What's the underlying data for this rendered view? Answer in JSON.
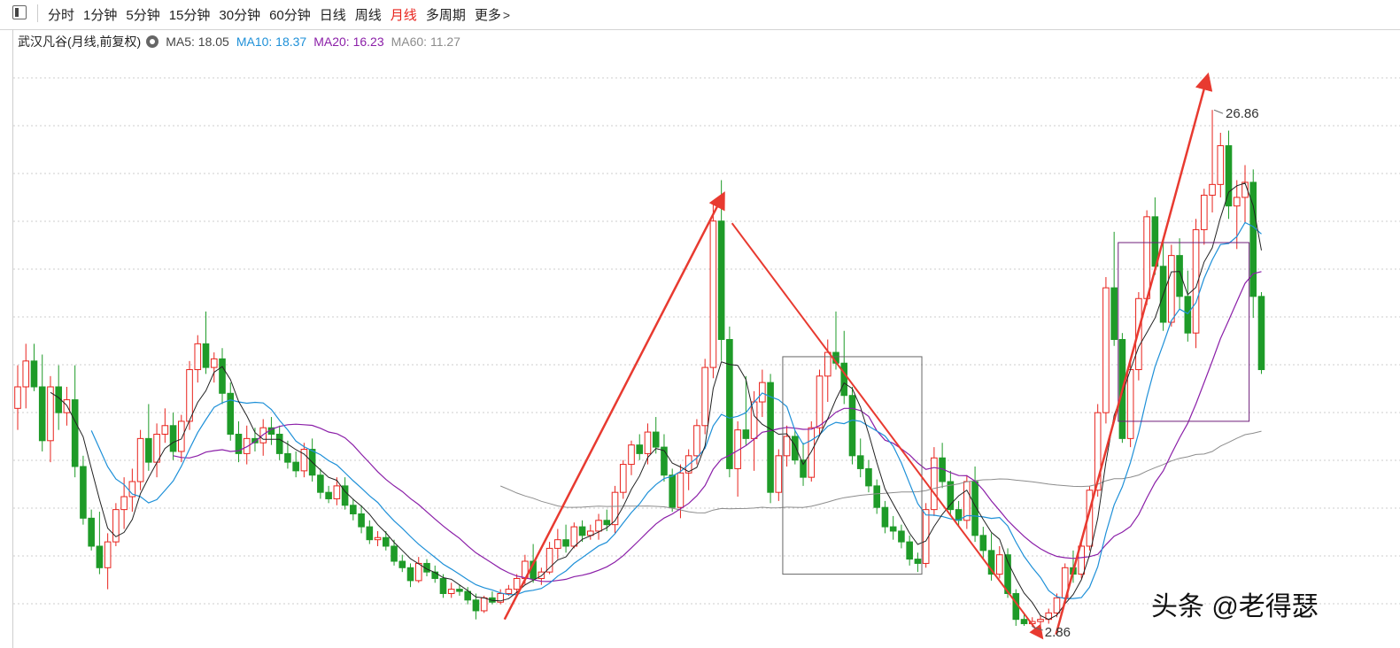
{
  "toolbar": {
    "tabs": [
      {
        "label": "分时"
      },
      {
        "label": "1分钟"
      },
      {
        "label": "5分钟"
      },
      {
        "label": "15分钟"
      },
      {
        "label": "30分钟"
      },
      {
        "label": "60分钟"
      },
      {
        "label": "日线"
      },
      {
        "label": "周线"
      },
      {
        "label": "月线",
        "active": true
      },
      {
        "label": "多周期"
      },
      {
        "label": "更多"
      }
    ]
  },
  "legend": {
    "stock_title": "武汉凡谷(月线,前复权)",
    "ma5": "MA5: 18.05",
    "ma10": "MA10: 18.37",
    "ma20": "MA20: 16.23",
    "ma60": "MA60: 11.27"
  },
  "annotations": {
    "high_label": "26.86",
    "low_label": "2.86"
  },
  "watermark": "头条 @老得瑟",
  "colors": {
    "up": "#e8231d",
    "down": "#1e9b28",
    "ma5": "#222222",
    "ma10": "#1e90d8",
    "ma20": "#8b1fa8",
    "ma60": "#8c8c8c",
    "arrow": "#e83a30",
    "grid": "#cccccc"
  },
  "chart_data": {
    "type": "candlestick",
    "period": "monthly",
    "ohlc": [
      [
        13,
        15,
        12,
        14
      ],
      [
        14,
        16,
        13,
        15.2
      ],
      [
        15.2,
        16,
        13.8,
        14
      ],
      [
        14,
        15.5,
        11,
        11.5
      ],
      [
        11.5,
        14.5,
        10.5,
        14
      ],
      [
        14,
        15,
        12,
        12.8
      ],
      [
        12.8,
        14,
        12.2,
        13.4
      ],
      [
        13.4,
        15,
        9.8,
        10.3
      ],
      [
        10.3,
        10.8,
        7.6,
        7.9
      ],
      [
        7.9,
        8.3,
        6.4,
        6.6
      ],
      [
        6.6,
        8.2,
        5.3,
        5.6
      ],
      [
        5.6,
        7.2,
        4.6,
        6.8
      ],
      [
        6.8,
        8.6,
        6.6,
        8.3
      ],
      [
        8.3,
        9.8,
        7.4,
        8.9
      ],
      [
        8.9,
        10.2,
        8.2,
        9.6
      ],
      [
        9.6,
        12,
        9.2,
        11.6
      ],
      [
        11.6,
        13.2,
        10.1,
        10.5
      ],
      [
        10.5,
        12.3,
        9.8,
        11.8
      ],
      [
        11.8,
        13,
        11.4,
        12.2
      ],
      [
        12.2,
        12.8,
        10.6,
        11
      ],
      [
        11,
        12.7,
        10.5,
        12.4
      ],
      [
        12.4,
        15.2,
        12,
        14.8
      ],
      [
        14.8,
        16.4,
        14.2,
        16
      ],
      [
        16,
        17.5,
        14.6,
        14.9
      ],
      [
        14.9,
        15.6,
        14.2,
        15.3
      ],
      [
        15.3,
        15.8,
        13.2,
        13.7
      ],
      [
        13.7,
        14.2,
        11.5,
        11.8
      ],
      [
        11.8,
        12.4,
        10.5,
        10.9
      ],
      [
        10.9,
        12.2,
        10.4,
        11.6
      ],
      [
        11.6,
        12.1,
        11,
        11.4
      ],
      [
        11.4,
        12.5,
        10.8,
        12.1
      ],
      [
        12.1,
        12.6,
        11.3,
        11.8
      ],
      [
        11.8,
        12.2,
        10.6,
        10.9
      ],
      [
        10.9,
        11.5,
        10.2,
        10.5
      ],
      [
        10.5,
        11,
        9.8,
        10.1
      ],
      [
        10.1,
        11.4,
        9.8,
        11.1
      ],
      [
        11.1,
        11.6,
        9.6,
        9.9
      ],
      [
        9.9,
        10.2,
        8.8,
        9.1
      ],
      [
        9.1,
        9.4,
        8.6,
        8.8
      ],
      [
        8.8,
        9.8,
        8.5,
        9.4
      ],
      [
        9.4,
        9.8,
        8.3,
        8.5
      ],
      [
        8.5,
        8.8,
        7.8,
        8.1
      ],
      [
        8.1,
        8.5,
        7.2,
        7.5
      ],
      [
        7.5,
        7.8,
        6.7,
        6.9
      ],
      [
        6.9,
        7.3,
        6.6,
        7
      ],
      [
        7,
        7.3,
        6.4,
        6.6
      ],
      [
        6.6,
        6.9,
        5.7,
        5.9
      ],
      [
        5.9,
        6.2,
        5.4,
        5.6
      ],
      [
        5.6,
        5.8,
        4.7,
        5
      ],
      [
        5,
        6.1,
        4.9,
        5.8
      ],
      [
        5.8,
        6,
        5.2,
        5.4
      ],
      [
        5.4,
        5.7,
        4.9,
        5.1
      ],
      [
        5.1,
        5.3,
        4.2,
        4.4
      ],
      [
        4.4,
        4.9,
        4.2,
        4.6
      ],
      [
        4.6,
        4.8,
        4.3,
        4.5
      ],
      [
        4.5,
        4.7,
        3.9,
        4.1
      ],
      [
        4.1,
        4.4,
        3.2,
        3.6
      ],
      [
        3.6,
        4.3,
        3.5,
        4.2
      ],
      [
        4.2,
        4.5,
        3.9,
        4
      ],
      [
        4,
        4.6,
        3.9,
        4.4
      ],
      [
        4.4,
        4.8,
        4.3,
        4.6
      ],
      [
        4.6,
        5.3,
        4.4,
        5.1
      ],
      [
        5.1,
        6.2,
        4.8,
        5.9
      ],
      [
        5.9,
        6.7,
        4.9,
        5.1
      ],
      [
        5.1,
        5.6,
        4.8,
        5.4
      ],
      [
        5.4,
        6.8,
        5.3,
        6.5
      ],
      [
        6.5,
        7.4,
        6,
        6.9
      ],
      [
        6.9,
        7.6,
        6.3,
        6.6
      ],
      [
        6.6,
        7.7,
        6.5,
        7.5
      ],
      [
        7.5,
        7.8,
        6.8,
        7.1
      ],
      [
        7.1,
        7.6,
        6.9,
        7.3
      ],
      [
        7.3,
        8.1,
        6.9,
        7.8
      ],
      [
        7.8,
        8.3,
        7.3,
        7.6
      ],
      [
        7.6,
        9.4,
        7.2,
        9.1
      ],
      [
        9.1,
        10.6,
        8.8,
        10.4
      ],
      [
        10.4,
        11.5,
        9.9,
        11.3
      ],
      [
        11.3,
        11.8,
        10.6,
        10.9
      ],
      [
        10.9,
        12.3,
        10.4,
        11.9
      ],
      [
        11.9,
        12.6,
        10.9,
        11.2
      ],
      [
        11.2,
        11.8,
        9.6,
        9.9
      ],
      [
        9.9,
        10.2,
        8.2,
        8.4
      ],
      [
        8.4,
        10.4,
        7.9,
        10
      ],
      [
        10,
        11.1,
        9.2,
        10.8
      ],
      [
        10.8,
        12.5,
        10.4,
        12.2
      ],
      [
        12.2,
        15.3,
        11.8,
        14.9
      ],
      [
        14.9,
        22.5,
        14.4,
        21.7
      ],
      [
        21.7,
        23.6,
        15.2,
        16.2
      ],
      [
        16.2,
        16.8,
        9.8,
        10.2
      ],
      [
        10.2,
        12.4,
        8.9,
        12
      ],
      [
        12,
        14.5,
        11.3,
        11.6
      ],
      [
        11.6,
        13.8,
        10.1,
        13.3
      ],
      [
        13.3,
        14.8,
        12.6,
        14.2
      ],
      [
        14.2,
        14.6,
        8.6,
        9.1
      ],
      [
        9.1,
        11.1,
        8.7,
        10.8
      ],
      [
        10.8,
        12.2,
        10.3,
        11.7
      ],
      [
        11.7,
        12,
        10.4,
        10.6
      ],
      [
        10.6,
        11.4,
        9.4,
        9.8
      ],
      [
        9.8,
        12.4,
        9.6,
        12.1
      ],
      [
        12.1,
        14.8,
        11.8,
        14.5
      ],
      [
        14.5,
        16.2,
        13.3,
        15.6
      ],
      [
        15.6,
        17.5,
        14.8,
        15.1
      ],
      [
        15.1,
        16.6,
        13.2,
        13.6
      ],
      [
        13.6,
        14,
        10.4,
        10.8
      ],
      [
        10.8,
        11.6,
        9.8,
        10.2
      ],
      [
        10.2,
        10.6,
        9.1,
        9.4
      ],
      [
        9.4,
        9.7,
        8.1,
        8.4
      ],
      [
        8.4,
        8.7,
        7.2,
        7.5
      ],
      [
        7.5,
        8,
        6.9,
        7.3
      ],
      [
        7.3,
        7.6,
        6.5,
        6.8
      ],
      [
        6.8,
        7.1,
        5.7,
        6
      ],
      [
        6,
        6.3,
        5.4,
        5.8
      ],
      [
        5.8,
        8.6,
        5.6,
        8.3
      ],
      [
        8.3,
        11.2,
        8,
        10.7
      ],
      [
        10.7,
        11.4,
        9.3,
        9.6
      ],
      [
        9.6,
        10.1,
        8,
        8.3
      ],
      [
        8.3,
        8.7,
        7.5,
        7.8
      ],
      [
        7.8,
        9.9,
        7.4,
        9.6
      ],
      [
        9.6,
        10.3,
        6.8,
        7.1
      ],
      [
        7.1,
        7.5,
        6,
        6.4
      ],
      [
        6.4,
        7.2,
        5,
        5.3
      ],
      [
        5.3,
        6.6,
        5.1,
        6.2
      ],
      [
        6.2,
        6.5,
        4.2,
        4.4
      ],
      [
        4.4,
        4.6,
        2.9,
        3.2
      ],
      [
        3.2,
        3.5,
        2.9,
        3
      ],
      [
        3,
        3.3,
        2.86,
        3.1
      ],
      [
        3.1,
        3.4,
        2.9,
        3.2
      ],
      [
        3.2,
        3.7,
        3,
        3.5
      ],
      [
        3.5,
        4.4,
        3.3,
        4.2
      ],
      [
        4.2,
        5.8,
        4,
        5.6
      ],
      [
        5.6,
        6.4,
        4.9,
        5.3
      ],
      [
        5.3,
        6.8,
        5.1,
        6.6
      ],
      [
        6.6,
        9.4,
        6.4,
        9.2
      ],
      [
        9.2,
        13.2,
        8.9,
        12.8
      ],
      [
        12.8,
        19.1,
        12.3,
        18.6
      ],
      [
        18.6,
        21.2,
        15.9,
        16.2
      ],
      [
        16.2,
        16.5,
        11.4,
        11.6
      ],
      [
        11.6,
        15.2,
        11.2,
        14.8
      ],
      [
        14.8,
        18.4,
        14.3,
        18.1
      ],
      [
        18.1,
        22.2,
        17.8,
        21.9
      ],
      [
        21.9,
        22.8,
        19.2,
        19.6
      ],
      [
        19.6,
        20.8,
        16.6,
        17
      ],
      [
        17,
        20.6,
        16.8,
        20.1
      ],
      [
        20.1,
        20.9,
        17.6,
        18.2
      ],
      [
        18.2,
        19.4,
        16.1,
        16.5
      ],
      [
        16.5,
        21.8,
        15.8,
        21.3
      ],
      [
        21.3,
        23.2,
        20.6,
        22.9
      ],
      [
        22.9,
        26.86,
        22.1,
        23.4
      ],
      [
        23.4,
        25.8,
        22.8,
        25.2
      ],
      [
        25.2,
        25.9,
        21.8,
        22.4
      ],
      [
        22.4,
        23.6,
        20.4,
        22.8
      ],
      [
        22.8,
        24.3,
        21.6,
        23.5
      ],
      [
        23.5,
        24.1,
        17.2,
        18.2
      ],
      [
        18.2,
        18.4,
        14.6,
        14.8
      ]
    ],
    "ma5_last": 18.05,
    "ma10_last": 18.37,
    "ma20_last": 16.23,
    "ma60_last": 11.27,
    "high": 26.86,
    "low": 2.86,
    "ylim": [
      2.2,
      29.5
    ]
  }
}
